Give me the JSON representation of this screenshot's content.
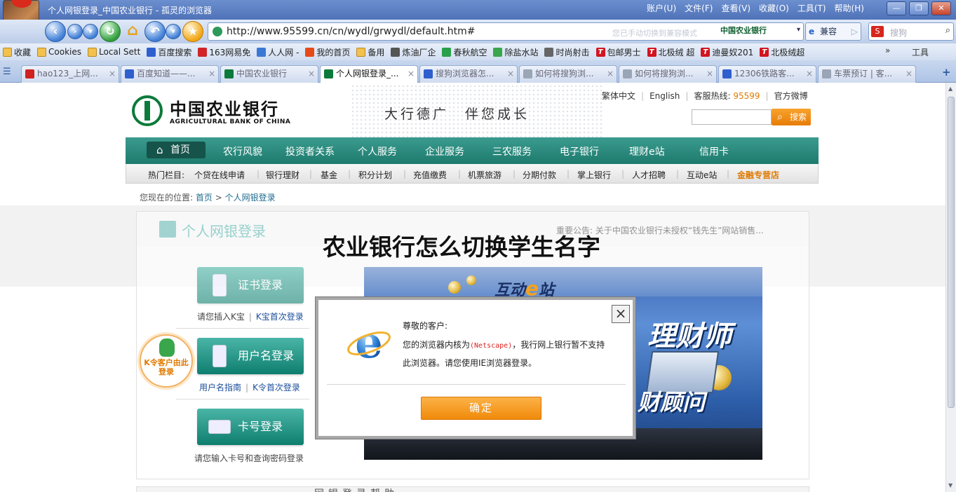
{
  "browser": {
    "window_title": "个人网银登录_中国农业银行 - 孤灵的浏览器",
    "menu": [
      "账户(U)",
      "文件(F)",
      "查看(V)",
      "收藏(O)",
      "工具(T)",
      "帮助(H)"
    ],
    "window_buttons": [
      "—",
      "❐",
      "✕"
    ],
    "url": "http://www.95599.cn/cn/wydl/grwydl/default.htm#",
    "url_hint": "您已手动切换到兼容模式",
    "url_site_badge": "中国农业银行",
    "compat_label": "兼容",
    "search_placeholder": "搜狗",
    "favorites": [
      {
        "label": "收藏",
        "icon": "folder-icon"
      },
      {
        "label": "Cookies",
        "icon": "folder-icon"
      },
      {
        "label": "Local Sett",
        "icon": "folder-icon"
      },
      {
        "label": "百度搜索",
        "icon": "paw-icon"
      },
      {
        "label": "163网易免",
        "icon": "site-icon"
      },
      {
        "label": "人人网 -",
        "icon": "site-icon"
      },
      {
        "label": "我的首页",
        "icon": "site-icon"
      },
      {
        "label": "备用",
        "icon": "folder-icon"
      },
      {
        "label": "炼油厂企",
        "icon": "site-icon"
      },
      {
        "label": "春秋航空",
        "icon": "site-icon"
      },
      {
        "label": "除盐水站",
        "icon": "site-icon"
      },
      {
        "label": "时尚射击",
        "icon": "site-icon"
      },
      {
        "label": "包邮男士",
        "icon": "tmall-icon"
      },
      {
        "label": "北极绒 超",
        "icon": "tmall-icon"
      },
      {
        "label": "迪曼奴201",
        "icon": "tmall-icon"
      },
      {
        "label": "北极绒超",
        "icon": "tmall-icon"
      }
    ],
    "favbar_more": "»",
    "favbar_tools": "工具",
    "tabs": [
      {
        "label": "hao123_上网..."
      },
      {
        "label": "百度知道——..."
      },
      {
        "label": "中国农业银行"
      },
      {
        "label": "个人网银登录_..."
      },
      {
        "label": "搜狗浏览器怎..."
      },
      {
        "label": "如何将搜狗浏..."
      },
      {
        "label": "如何将搜狗浏..."
      },
      {
        "label": "12306铁路客..."
      },
      {
        "label": "车票预订 | 客..."
      }
    ],
    "tab_close": "×",
    "new_tab": "+"
  },
  "site": {
    "logo_cn": "中国农业银行",
    "logo_en": "AGRICULTURAL BANK OF CHINA",
    "slogan": "大行德广　伴您成长",
    "top_links": {
      "traditional": "繁体中文",
      "english": "English",
      "hotline_label": "客服热线:",
      "hotline_number": "95599",
      "weibo": "官方微博"
    },
    "search_button": "搜索",
    "nav": {
      "home": "首页",
      "items": [
        "农行风貌",
        "投资者关系",
        "个人服务",
        "企业服务",
        "三农服务",
        "电子银行",
        "理财e站",
        "信用卡"
      ]
    },
    "subnav": {
      "label": "热门栏目:",
      "items": [
        "个贷在线申请",
        "银行理财",
        "基金",
        "积分计划",
        "充值缴费",
        "机票旅游",
        "分期付款",
        "掌上银行",
        "人才招聘",
        "互动e站"
      ],
      "highlight": "金融专营店"
    },
    "breadcrumb": {
      "prefix": "您现在的位置:",
      "home": "首页",
      "sep": ">",
      "current": "个人网银登录"
    },
    "panel": {
      "title": "个人网银登录",
      "notice": "重要公告: 关于中国农业银行未授权“钱先生”网站销售...",
      "cert_login": "证书登录",
      "cert_note_a": "请您插入K宝",
      "cert_note_b": "K宝首次登录",
      "user_login": "用户名登录",
      "user_note_a": "用户名指南",
      "user_note_b": "K令首次登录",
      "card_login": "卡号登录",
      "card_note": "请您输入卡号和查询密码登录",
      "ktoken_text": "K令客户由此登录",
      "bottom_text": "网银登录帮助"
    },
    "banner": {
      "logo_text": "互动",
      "logo_e": "e",
      "logo_suffix": "站",
      "big1": "理财师",
      "big2": "财顾问"
    }
  },
  "overlay_title": "农业银行怎么切换学生名字",
  "dialog": {
    "close_label": "×",
    "greeting": "尊敬的客户:",
    "body_a": "您的浏览器内核为",
    "core": "(Netscape)",
    "body_b": "，我行网上银行暂不支持此浏览器。请您使用IE浏览器登录。",
    "ok_label": "确定"
  },
  "colors": {
    "bank_green": "#1e7b6e",
    "accent_orange": "#f08a0a",
    "browser_blue": "#4f73b8"
  }
}
